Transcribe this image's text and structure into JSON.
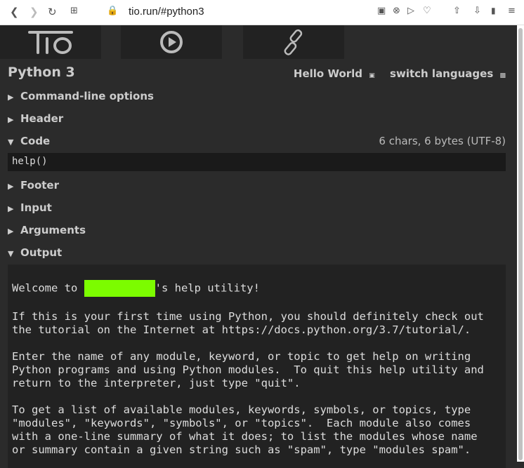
{
  "browser": {
    "url": "tio.run/#python3"
  },
  "header": {
    "language": "Python 3",
    "hello_world": "Hello World",
    "switch_languages": "switch languages"
  },
  "sections": [
    {
      "label": "Command-line options",
      "open": false
    },
    {
      "label": "Header",
      "open": false
    },
    {
      "label": "Code",
      "open": true
    },
    {
      "label": "Footer",
      "open": false
    },
    {
      "label": "Input",
      "open": false
    },
    {
      "label": "Arguments",
      "open": false
    },
    {
      "label": "Output",
      "open": true
    }
  ],
  "code": {
    "value": "help()",
    "count": "6 chars, 6 bytes (UTF-8)"
  },
  "output": {
    "welcome_pre": "Welcome to ",
    "welcome_post": "'s help utility!",
    "body": "\nIf this is your first time using Python, you should definitely check out\nthe tutorial on the Internet at https://docs.python.org/3.7/tutorial/.\n\nEnter the name of any module, keyword, or topic to get help on writing\nPython programs and using Python modules.  To quit this help utility and\nreturn to the interpreter, just type \"quit\".\n\nTo get a list of available modules, keywords, symbols, or topics, type\n\"modules\", \"keywords\", \"symbols\", or \"topics\".  Each module also comes\nwith a one-line summary of what it does; to list the modules whose name\nor summary contain a given string such as \"spam\", type \"modules spam\"."
  }
}
